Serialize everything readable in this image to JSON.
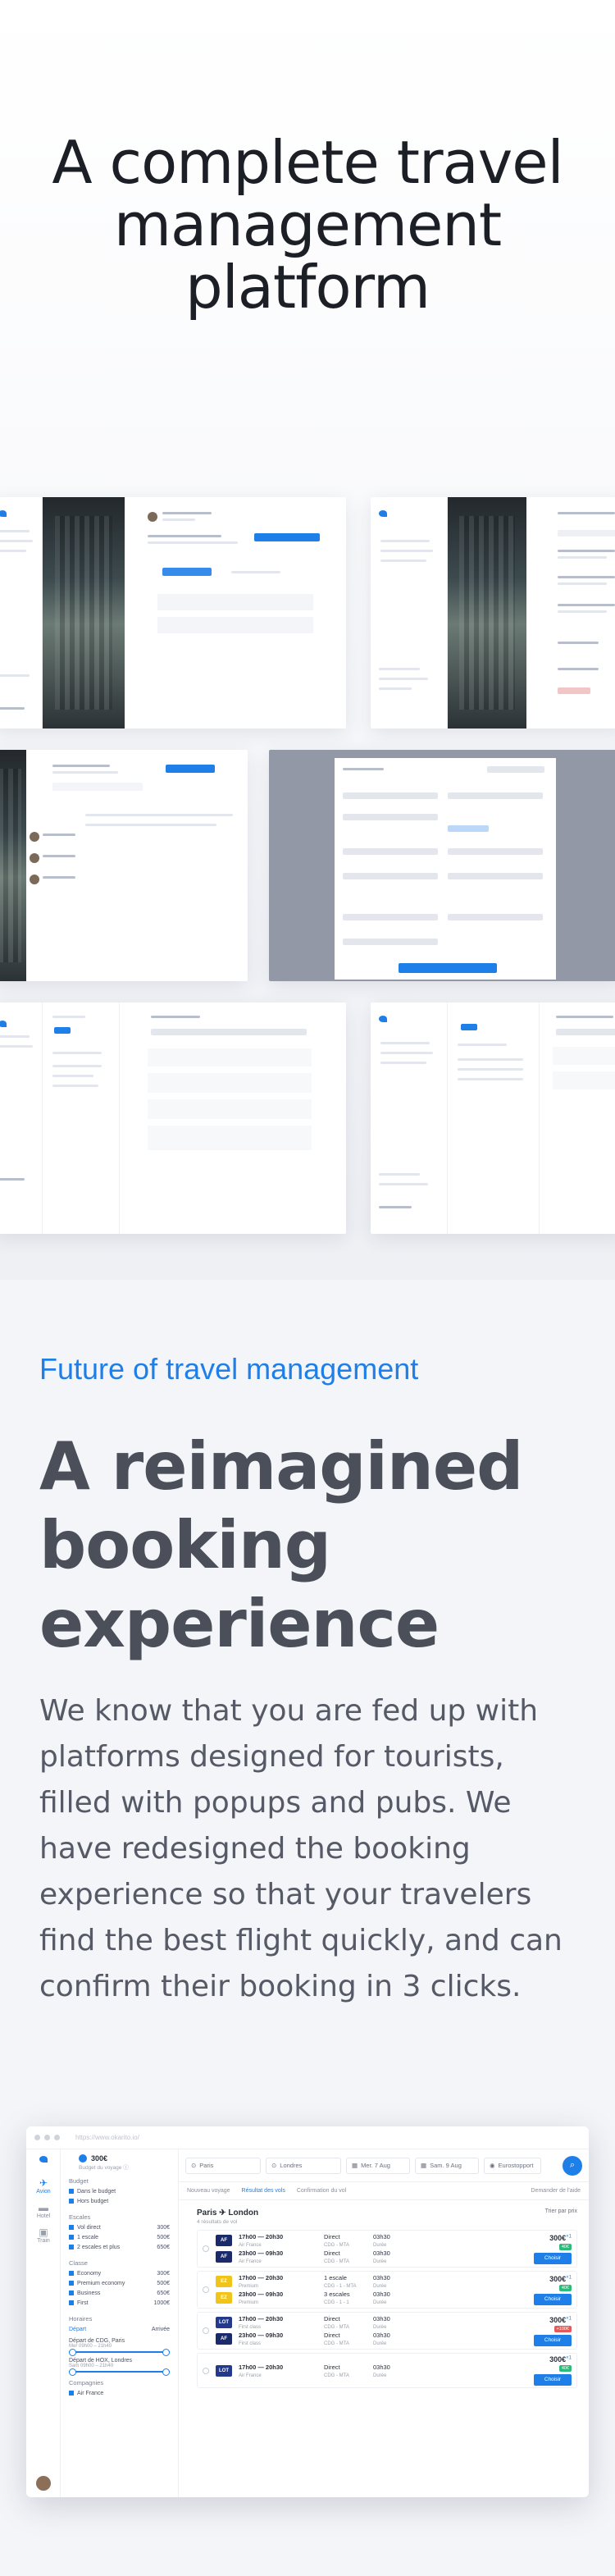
{
  "hero": {
    "line1": "A complete travel",
    "line2": "management",
    "line3": "platform"
  },
  "section": {
    "eyebrow": "Future of travel management",
    "title_line1": "A reimagined",
    "title_line2": "booking",
    "title_line3": "experience",
    "paragraph": "We know that you are fed up with platforms designed for tourists, filled with popups and pubs. We have redesigned the booking experience so that your travelers find the best flight quickly, and can confirm their booking in 3 clicks."
  },
  "app": {
    "url": "https://www.okarito.io/",
    "nav": [
      {
        "label": "Avion",
        "icon": "plane-icon",
        "glyph": "✈"
      },
      {
        "label": "Hotel",
        "icon": "bed-icon",
        "glyph": "▬"
      },
      {
        "label": "Train",
        "icon": "train-icon",
        "glyph": "▣"
      }
    ],
    "budget": {
      "amount": "300€",
      "label": "Budget du voyage ⓘ"
    },
    "filters": {
      "budget_title": "Budget",
      "budget_options": [
        "Dans le budget",
        "Hors budget"
      ],
      "stops_title": "Escales",
      "stops": [
        {
          "label": "Vol direct",
          "price": "300€"
        },
        {
          "label": "1 escale",
          "price": "500€"
        },
        {
          "label": "2 escales et plus",
          "price": "650€"
        }
      ],
      "class_title": "Classe",
      "classes": [
        {
          "label": "Economy",
          "price": "300€"
        },
        {
          "label": "Premium economy",
          "price": "500€"
        },
        {
          "label": "Business",
          "price": "650€"
        },
        {
          "label": "First",
          "price": "1000€"
        }
      ],
      "hours_title": "Horaires",
      "hours_tabs": [
        "Départ",
        "Arrivée"
      ],
      "dep_cdg": "Départ de CDG, Paris",
      "dep_cdg_range": "Mer 09h00 – 21h40",
      "dep_lhr": "Départ de HOX, Londres",
      "dep_lhr_range": "Sam 09h00 – 21h40",
      "airlines_title": "Compagnies",
      "airline_first": "Air France"
    },
    "search": {
      "from": "Paris",
      "to": "Londres",
      "date_out": "Mer. 7 Aug",
      "date_back": "Sam. 9 Aug",
      "traveler": "Eurostopport"
    },
    "crumbs": {
      "step1": "Nouveau voyage",
      "step2": "Résultat des vols",
      "step3": "Confirmation du vol",
      "help": "Demander de l'aide"
    },
    "results": {
      "route": "Paris ✈ London",
      "count": "4 résultats de vol",
      "sort": "Trier par prix",
      "choose_label": "Choisir",
      "offers": [
        {
          "price": "300€",
          "badge": "×1",
          "tag": "40€",
          "tag_color": "green",
          "legs": [
            {
              "logo": "AF",
              "logo_color": "#1b2a6b",
              "times": "17h00 — 20h30",
              "airline": "Air France",
              "stops": "Direct",
              "airports": "CDG - MTA",
              "duration": "03h30",
              "dur_label": "Durée"
            },
            {
              "logo": "AF",
              "logo_color": "#1b2a6b",
              "times": "23h00 — 09h30",
              "airline": "Air France",
              "stops": "Direct",
              "airports": "CDG - MTA",
              "duration": "03h30",
              "dur_label": "Durée"
            }
          ]
        },
        {
          "price": "300€",
          "badge": "×1",
          "tag": "40€",
          "tag_color": "green",
          "legs": [
            {
              "logo": "EZ",
              "logo_color": "#f0c419",
              "times": "17h00 — 20h30",
              "airline": "Premium",
              "stops": "1 escale",
              "airports": "CDG - 1 - MTA",
              "duration": "03h30",
              "dur_label": "Durée"
            },
            {
              "logo": "EZ",
              "logo_color": "#f0c419",
              "times": "23h00 — 09h30",
              "airline": "Premium",
              "stops": "3 escales",
              "airports": "CDG - 1 - 1",
              "duration": "03h30",
              "dur_label": "Durée"
            }
          ]
        },
        {
          "price": "300€",
          "badge": "×1",
          "tag": "+100€",
          "tag_color": "red",
          "legs": [
            {
              "logo": "LOT",
              "logo_color": "#233a8c",
              "times": "17h00 — 20h30",
              "airline": "First class",
              "stops": "Direct",
              "airports": "CDG - MTA",
              "duration": "03h30",
              "dur_label": "Durée"
            },
            {
              "logo": "AF",
              "logo_color": "#1b2a6b",
              "times": "23h00 — 09h30",
              "airline": "First class",
              "stops": "Direct",
              "airports": "CDG - MTA",
              "duration": "03h30",
              "dur_label": "Durée"
            }
          ]
        },
        {
          "price": "300€",
          "badge": "×1",
          "tag": "40€",
          "tag_color": "green",
          "legs": [
            {
              "logo": "LOT",
              "logo_color": "#233a8c",
              "times": "17h00 — 20h30",
              "airline": "Air France",
              "stops": "Direct",
              "airports": "CDG - MTA",
              "duration": "03h30",
              "dur_label": "Durée"
            }
          ]
        }
      ]
    }
  }
}
